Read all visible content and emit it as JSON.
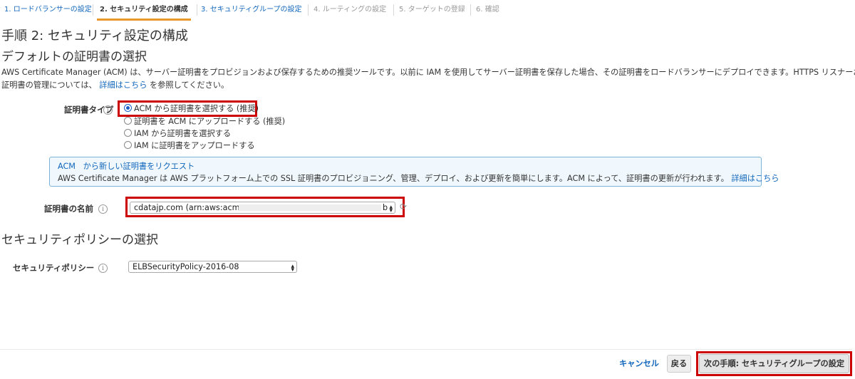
{
  "steps": [
    {
      "label": "1. ロードバランサーの設定",
      "state": "link"
    },
    {
      "label": "2. セキュリティ設定の構成",
      "state": "current"
    },
    {
      "label": "3. セキュリティグループの設定",
      "state": "link"
    },
    {
      "label": "4. ルーティングの設定",
      "state": "disabled"
    },
    {
      "label": "5. ターゲットの登録",
      "state": "disabled"
    },
    {
      "label": "6. 確認",
      "state": "disabled"
    }
  ],
  "page_title": "手順 2: セキュリティ設定の構成",
  "cert_section": {
    "title": "デフォルトの証明書の選択",
    "desc_line1": "AWS Certificate Manager (ACM) は、サーバー証明書をプロビジョンおよび保存するための推奨ツールです。以前に IAM を使用してサーバー証明書を保存した場合、その証明書をロードバランサーにデプロイできます。HTTPS リスナーおよび",
    "desc_line2_pre": "証明書の管理については、",
    "desc_link": "詳細はこちら",
    "desc_line2_post": " を参照してください。",
    "cert_type_label": "証明書タイプ",
    "info_icon": "i",
    "radio_options": [
      {
        "label": "ACM から証明書を選択する (推奨)",
        "selected": true
      },
      {
        "label": "証明書を ACM にアップロードする (推奨)",
        "selected": false
      },
      {
        "label": "IAM から証明書を選択する",
        "selected": false
      },
      {
        "label": "IAM に証明書をアップロードする",
        "selected": false
      }
    ],
    "acm_box": {
      "link1": "ACM",
      "link2": "から新しい証明書をリクエスト",
      "text": "AWS Certificate Manager は AWS プラットフォーム上での SSL 証明書のプロビジョニング、管理、デプロイ、および更新を簡単にします。ACM によって、証明書の更新が行われます。",
      "more_link": "詳細はこちら"
    },
    "cert_name_label": "証明書の名前",
    "cert_name_value": "cdatajp.com (arn:aws:acm:",
    "cert_name_tail": "b",
    "refresh_icon": "⟳"
  },
  "policy_section": {
    "title": "セキュリティポリシーの選択",
    "label": "セキュリティポリシー",
    "value": "ELBSecurityPolicy-2016-08"
  },
  "footer": {
    "cancel": "キャンセル",
    "back": "戻る",
    "next": "次の手順: セキュリティグループの設定"
  },
  "colors": {
    "link": "#1166bb",
    "highlight": "#cc0000",
    "step_underline": "#e79a2a",
    "radio": "#1a5fc9"
  }
}
